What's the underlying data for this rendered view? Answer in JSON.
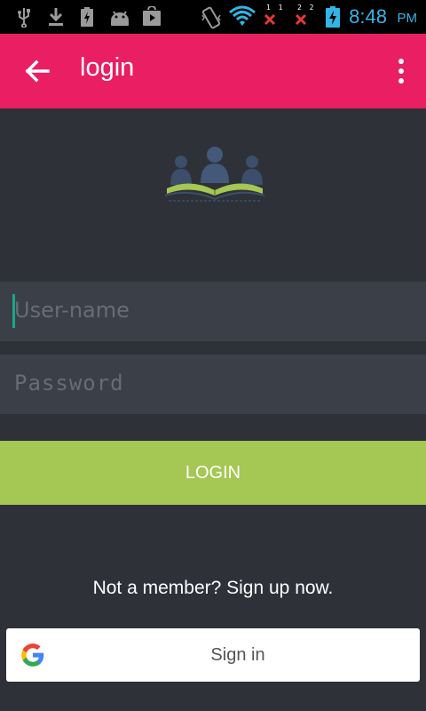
{
  "status_bar": {
    "time": "8:48",
    "ampm": "PM",
    "sim1": "1 1",
    "sim2": "2 2",
    "icons": [
      "usb-icon",
      "download-icon",
      "battery-charging-icon",
      "android-icon",
      "play-store-icon",
      "vibrate-icon",
      "wifi-icon",
      "no-signal-icon",
      "no-signal-icon",
      "battery-icon"
    ],
    "accent": "#33b5e5"
  },
  "app_bar": {
    "title": "login",
    "color": "#e91e63"
  },
  "form": {
    "username_placeholder": "User-name",
    "password_placeholder": "Password",
    "login_label": "LOGIN",
    "login_color": "#a5c753"
  },
  "signup": {
    "text": "Not a member? Sign up now."
  },
  "google": {
    "label": "Sign in"
  }
}
